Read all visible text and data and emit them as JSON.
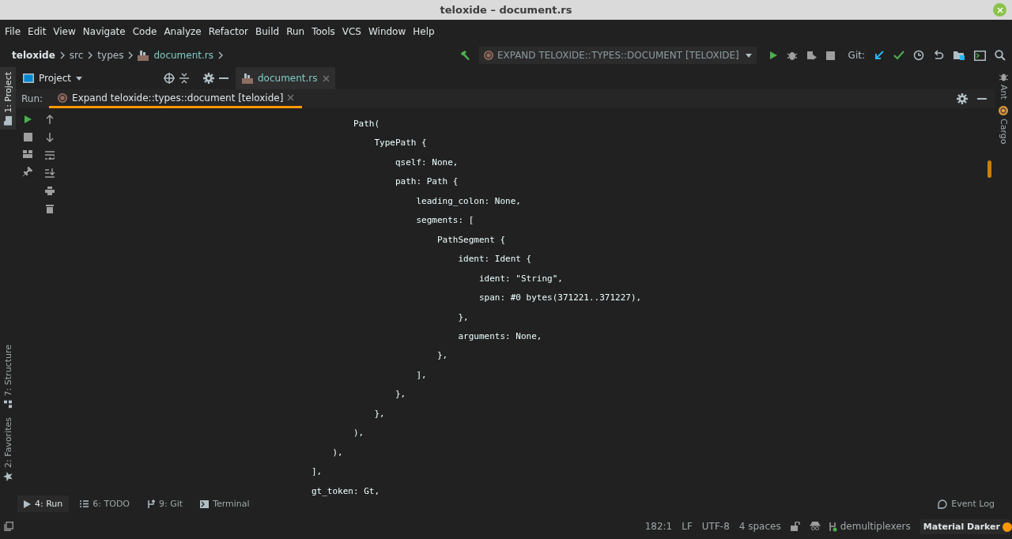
{
  "window": {
    "title": "teloxide – document.rs"
  },
  "menu": [
    "File",
    "Edit",
    "View",
    "Navigate",
    "Code",
    "Analyze",
    "Refactor",
    "Build",
    "Run",
    "Tools",
    "VCS",
    "Window",
    "Help"
  ],
  "breadcrumb": [
    {
      "label": "teloxide",
      "kind": "project"
    },
    {
      "label": "src",
      "kind": "folder"
    },
    {
      "label": "types",
      "kind": "folder"
    },
    {
      "label": "document.rs",
      "kind": "file"
    }
  ],
  "toolbar": {
    "run_config": "EXPAND TELOXIDE::TYPES::DOCUMENT [TELOXIDE]",
    "git_label": "Git:"
  },
  "left_stripe": [
    {
      "label": "1: Project",
      "selected": true,
      "kind": "project"
    },
    {
      "label": "7: Structure",
      "selected": false,
      "kind": "structure"
    },
    {
      "label": "2: Favorites",
      "selected": false,
      "kind": "favorites"
    }
  ],
  "right_stripe": [
    {
      "label": "Ant",
      "kind": "ant"
    },
    {
      "label": "Cargo",
      "kind": "cargo"
    }
  ],
  "project_panel": {
    "title": "Project"
  },
  "editor_tabs": [
    {
      "label": "document.rs",
      "selected": true
    }
  ],
  "run_panel": {
    "label": "Run:",
    "tabs": [
      {
        "label": "Expand teloxide::types::document [teloxide]",
        "selected": true
      }
    ],
    "output_lines": [
      "        Path(",
      "            TypePath {",
      "                qself: None,",
      "                path: Path {",
      "                    leading_colon: None,",
      "                    segments: [",
      "                        PathSegment {",
      "                            ident: Ident {",
      "                                ident: \"String\",",
      "                                span: #0 bytes(371221..371227),",
      "                            },",
      "                            arguments: None,",
      "                        },",
      "                    ],",
      "                },",
      "            },",
      "        ),",
      "    ),",
      "],",
      "gt_token: Gt,"
    ]
  },
  "tool_windows": [
    {
      "label": "4: Run",
      "selected": true,
      "kind": "run"
    },
    {
      "label": "6: TODO",
      "selected": false,
      "kind": "todo"
    },
    {
      "label": "9: Git",
      "selected": false,
      "kind": "git"
    },
    {
      "label": "Terminal",
      "selected": false,
      "kind": "terminal"
    }
  ],
  "event_log": "Event Log",
  "status_bar": {
    "position": "182:1",
    "line_separator": "LF",
    "encoding": "UTF-8",
    "indent": "4 spaces",
    "branch": "demultiplexers",
    "theme": "Material Darker"
  }
}
